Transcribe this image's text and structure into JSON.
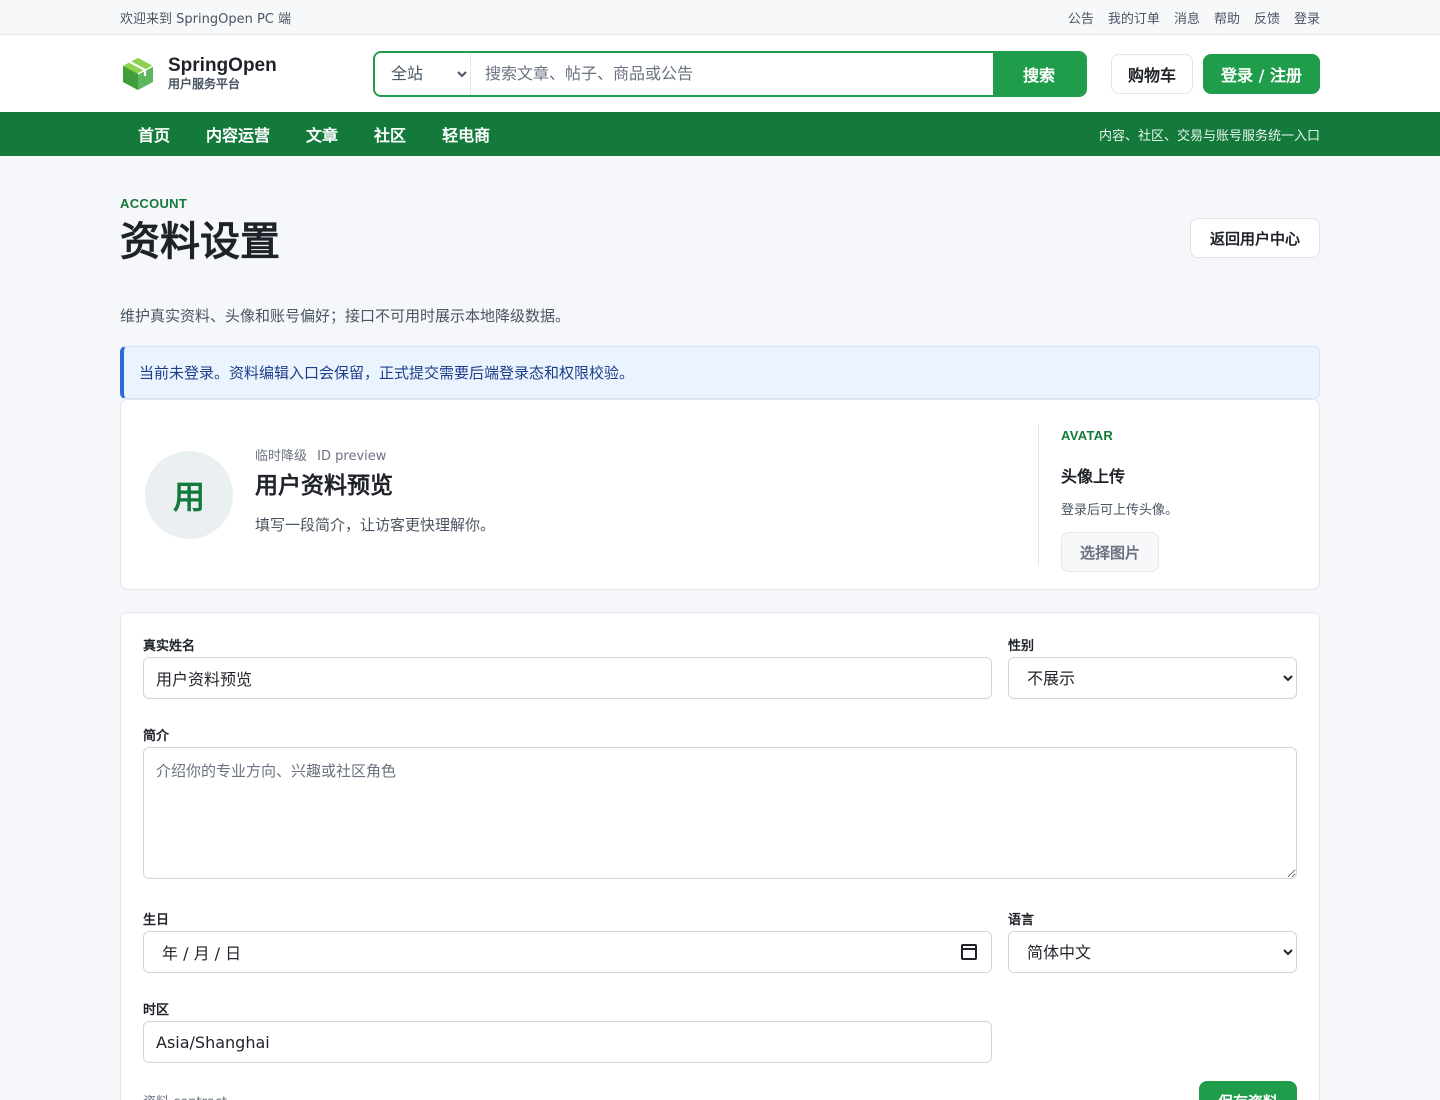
{
  "topbar": {
    "welcome": "欢迎来到 SpringOpen PC 端",
    "links": [
      "公告",
      "我的订单",
      "消息",
      "帮助",
      "反馈",
      "登录"
    ]
  },
  "header": {
    "brand_name": "SpringOpen",
    "brand_sub": "用户服务平台",
    "search_scope": "全站",
    "search_placeholder": "搜索文章、帖子、商品或公告",
    "search_button": "搜索",
    "cart_button": "购物车",
    "login_button": "登录 / 注册"
  },
  "nav": {
    "items": [
      "首页",
      "内容运营",
      "文章",
      "社区",
      "轻电商"
    ],
    "slogan": "内容、社区、交易与账号服务统一入口"
  },
  "page": {
    "eyebrow": "ACCOUNT",
    "title": "资料设置",
    "back_button": "返回用户中心",
    "description": "维护真实资料、头像和账号偏好；接口不可用时展示本地降级数据。",
    "notice": "当前未登录。资料编辑入口会保留，正式提交需要后端登录态和权限校验。"
  },
  "profile": {
    "avatar_char": "用",
    "meta_tag": "临时降级",
    "meta_id": "ID preview",
    "name": "用户资料预览",
    "bio": "填写一段简介，让访客更快理解你。"
  },
  "avatar_panel": {
    "eyebrow": "AVATAR",
    "title": "头像上传",
    "hint": "登录后可上传头像。",
    "choose_button": "选择图片"
  },
  "form": {
    "real_name_label": "真实姓名",
    "real_name_value": "用户资料预览",
    "gender_label": "性别",
    "gender_value": "不展示",
    "bio_label": "简介",
    "bio_placeholder": "介绍你的专业方向、兴趣或社区角色",
    "birthday_label": "生日",
    "birthday_placeholder": "年 / 月 / 日",
    "language_label": "语言",
    "language_value": "简体中文",
    "timezone_label": "时区",
    "timezone_value": "Asia/Shanghai",
    "contract_text": "资料 contract",
    "save_button": "保存资料"
  },
  "colors": {
    "brand_green": "#1f9d4a",
    "nav_green": "#147a3b",
    "notice_blue": "#2d6bd6"
  }
}
